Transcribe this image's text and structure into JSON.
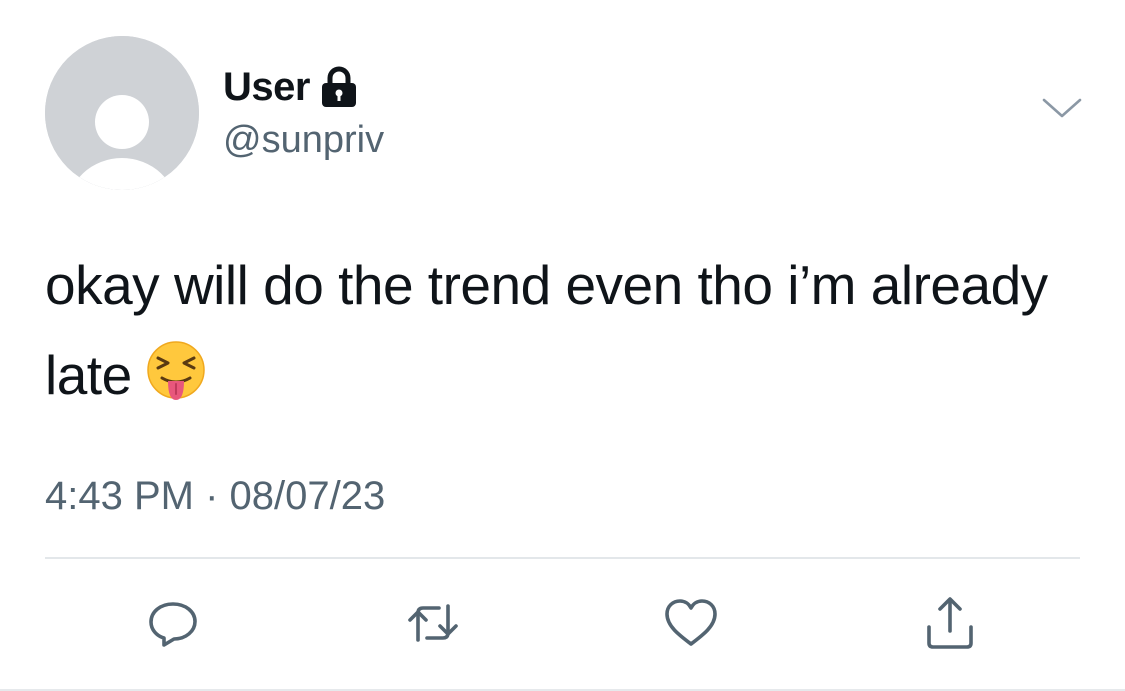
{
  "tweet": {
    "display_name": "User",
    "handle": "@sunpriv",
    "protected": true,
    "text": "okay will do the trend even tho i’m already late",
    "emoji": "squinting-face-with-tongue",
    "time": "4:43 PM",
    "separator": "·",
    "date": "08/07/23"
  },
  "icons": {
    "avatar": "default-avatar-icon",
    "lock": "lock-icon",
    "menu": "chevron-down-icon",
    "reply": "reply-icon",
    "retweet": "retweet-icon",
    "like": "heart-icon",
    "share": "share-icon"
  },
  "colors": {
    "text_primary": "#0f1419",
    "text_secondary": "#536471",
    "avatar_bg": "#cfd2d6",
    "divider": "#e3e7ea",
    "action_icon": "#536471"
  }
}
